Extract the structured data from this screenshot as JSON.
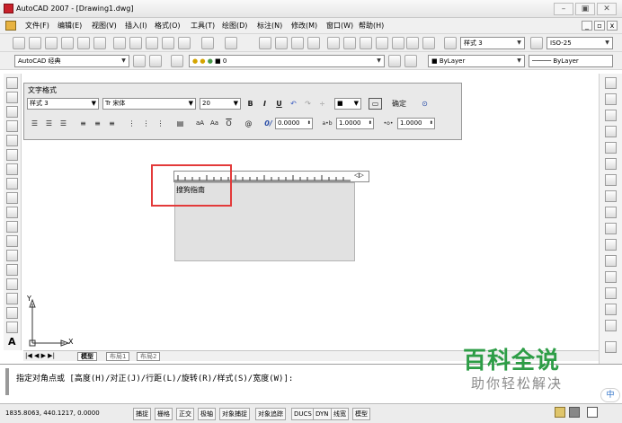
{
  "window": {
    "title": "AutoCAD 2007 - [Drawing1.dwg]",
    "min": "–",
    "max": "▣",
    "close": "✕"
  },
  "menu": [
    "文件(F)",
    "编辑(E)",
    "视图(V)",
    "插入(I)",
    "格式(O)",
    "工具(T)",
    "绘图(D)",
    "标注(N)",
    "修改(M)",
    "窗口(W)",
    "帮助(H)"
  ],
  "mdi": {
    "min": "_",
    "restore": "▫",
    "close": "x"
  },
  "toolbar1": {
    "text_style": "样式 3",
    "dim_style": "ISO-25"
  },
  "toolbar2": {
    "workspace": "AutoCAD 经典",
    "layer": "0",
    "color": "ByLayer",
    "linetype": "ByLayer"
  },
  "text_format": {
    "title": "文字格式",
    "style": "样式 3",
    "font": "宋体",
    "font_prefix": "Tr",
    "height": "20",
    "bold": "B",
    "italic": "I",
    "underline": "U",
    "ok": "确定",
    "oblique": "0.0000",
    "tracking": "1.0000",
    "width": "1.0000",
    "at_symbol": "@",
    "oblique_label": "0/",
    "tracking_label": "a•b",
    "width_label": "•o•"
  },
  "editor": {
    "text": "搜狗指南",
    "ruler_marker": "◁▷"
  },
  "ucs": {
    "x": "X",
    "y": "Y"
  },
  "tabs": [
    "模型",
    "布局1",
    "布局2"
  ],
  "command": {
    "line": "指定对角点或 [高度(H)/对正(J)/行距(L)/旋转(R)/样式(S)/宽度(W)]:"
  },
  "status": {
    "coords": "1835.8063, 440.1217, 0.0000",
    "buttons": [
      "捕捉",
      "栅格",
      "正交",
      "极轴",
      "对象捕捉",
      "对象追踪",
      "DUCS",
      "DYN",
      "线宽",
      "模型"
    ]
  },
  "watermark": {
    "big": "百科全说",
    "small": "助你轻松解决",
    "corner": "中"
  }
}
